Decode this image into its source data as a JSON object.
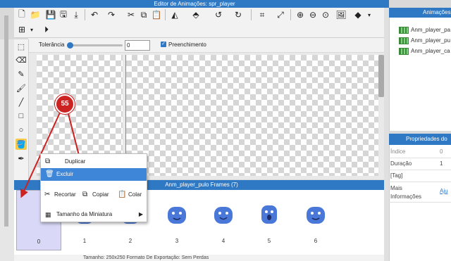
{
  "window": {
    "title": "Editor de Animações: spr_player"
  },
  "toolbar": {
    "tolerance_label": "Tolerância",
    "tolerance_value": "0",
    "tolerance_level": 0,
    "fill_label": "Preenchimento",
    "fill_checked": true
  },
  "frames_panel": {
    "title": "Anm_player_pulo Frames (7)",
    "frames": [
      "0",
      "1",
      "2",
      "3",
      "4",
      "5",
      "6"
    ],
    "status": "Tamanho: 250x250   Formato De Exportação: Sem Perdas"
  },
  "context_menu": {
    "duplicate": "Duplicar",
    "delete": "Excluir",
    "cut": "Recortar",
    "copy": "Copiar",
    "paste": "Colar",
    "thumb_size": "Tamanho da Miniatura"
  },
  "annotation": {
    "badge": "55"
  },
  "animations_panel": {
    "title": "Animações",
    "items": [
      "Anm_player_pa",
      "Anm_player_pu",
      "Anm_player_ca"
    ]
  },
  "properties_panel": {
    "title": "Propriedades do",
    "rows": [
      {
        "label": "Índice",
        "value": "0"
      },
      {
        "label": "Duração",
        "value": "1"
      },
      {
        "label": "[Tag]",
        "value": ""
      },
      {
        "label": "Mais Informações",
        "value": "Aju"
      }
    ]
  },
  "colors": {
    "accent": "#2f78c4",
    "selection": "#d9d9f7",
    "annotation": "#cc2222",
    "menu_highlight": "#3d86d8"
  }
}
